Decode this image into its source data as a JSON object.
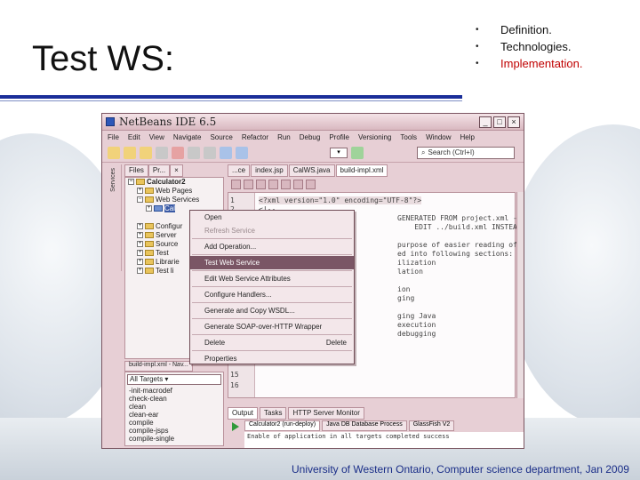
{
  "slide": {
    "title": "Test WS:",
    "bullets": [
      {
        "text": "Definition.",
        "highlight": false
      },
      {
        "text": "Technologies.",
        "highlight": false
      },
      {
        "text": "Implementation.",
        "highlight": true
      }
    ],
    "footer": "University of Western Ontario, Computer science department, Jan 2009",
    "accent_color": "#1a2e99",
    "highlight_color": "#c00000"
  },
  "netbeans": {
    "title": "NetBeans IDE 6.5",
    "window_buttons": [
      "_",
      "□",
      "×"
    ],
    "menubar": [
      "File",
      "Edit",
      "View",
      "Navigate",
      "Source",
      "Refactor",
      "Run",
      "Debug",
      "Profile",
      "Versioning",
      "Tools",
      "Window",
      "Help"
    ],
    "search_placeholder": "Search (Ctrl+I)",
    "left_strip_label": "Services",
    "panel_tabs": [
      "Files",
      "Pr...",
      "×"
    ],
    "tree": [
      {
        "label": "Calculator2",
        "level": 0,
        "bold": true
      },
      {
        "label": "Web Pages",
        "level": 1
      },
      {
        "label": "Web Services",
        "level": 1
      },
      {
        "label": "Cal",
        "level": 2,
        "selected": true
      },
      {
        "label": "Configur",
        "level": 1
      },
      {
        "label": "Server",
        "level": 1
      },
      {
        "label": "Source",
        "level": 1
      },
      {
        "label": "Test",
        "level": 1
      },
      {
        "label": "Librarie",
        "level": 1
      },
      {
        "label": "Test li",
        "level": 1
      }
    ],
    "bottom_panel_tabs": [
      "build-impl.xml - Nav..."
    ],
    "targets_select": "All Targets",
    "targets": [
      "-init-macrodef",
      "check-clean",
      "clean",
      "clean-ear",
      "compile",
      "compile-jsps",
      "compile-single"
    ],
    "editor_tabs": [
      {
        "label": "...ce",
        "active": false
      },
      {
        "label": "index.jsp",
        "active": false
      },
      {
        "label": "CalWS.java",
        "active": false
      },
      {
        "label": "build-impl.xml",
        "active": true
      }
    ],
    "editor_lines": [
      "<?xml version=\"1.0\" encoding=\"UTF-8\"?>",
      "<!--",
      "GENERATED FROM project.xml - DO",
      "    EDIT ../build.xml INSTEAD",
      "",
      "purpose of easier reading of",
      "ed into following sections:",
      "ilization",
      "lation",
      "",
      "ion",
      "ging",
      "",
      "ging Java",
      "execution",
      "debugging"
    ],
    "gutter_numbers": [
      "1",
      "2",
      "15",
      "16"
    ],
    "output_tabs": [
      {
        "label": "Output",
        "active": true
      },
      {
        "label": "Tasks",
        "active": false
      },
      {
        "label": "HTTP Server Monitor",
        "active": false
      }
    ],
    "output_subtabs": [
      {
        "label": "Calculator2 (run-deploy)",
        "active": true
      },
      {
        "label": "Java DB Database Process",
        "active": false
      },
      {
        "label": "GlassFish V2",
        "active": false
      }
    ],
    "output_text": "Enable of application in all targets completed success"
  },
  "context_menu": {
    "items": [
      {
        "label": "Open",
        "enabled": true
      },
      {
        "label": "Refresh Service",
        "enabled": false
      },
      {
        "separator": true
      },
      {
        "label": "Add Operation...",
        "enabled": true
      },
      {
        "separator": true
      },
      {
        "label": "Test Web Service",
        "enabled": true,
        "highlighted": true
      },
      {
        "separator": true
      },
      {
        "label": "Edit Web Service Attributes",
        "enabled": true
      },
      {
        "separator": true
      },
      {
        "label": "Configure Handlers...",
        "enabled": true
      },
      {
        "separator": true
      },
      {
        "label": "Generate and Copy WSDL...",
        "enabled": true
      },
      {
        "separator": true
      },
      {
        "label": "Generate SOAP-over-HTTP Wrapper",
        "enabled": true
      },
      {
        "separator": true
      },
      {
        "label": "Delete",
        "shortcut": "Delete",
        "enabled": true
      },
      {
        "separator": true
      },
      {
        "label": "Properties",
        "enabled": true
      }
    ]
  }
}
